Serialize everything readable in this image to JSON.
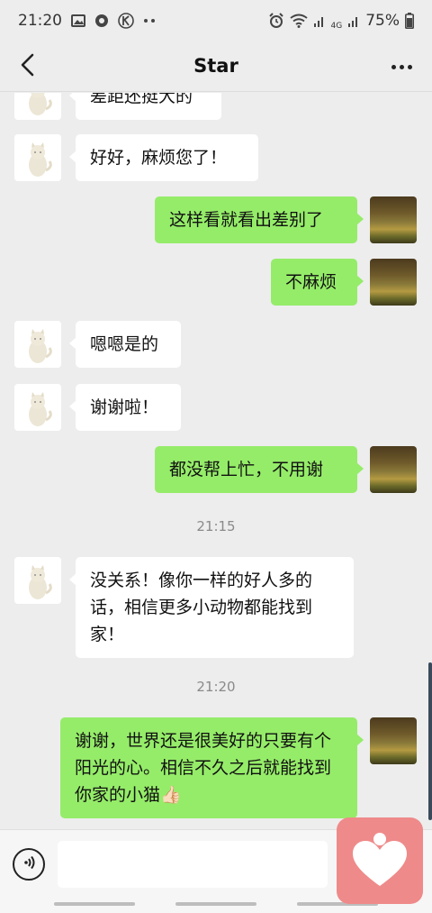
{
  "status_bar": {
    "time": "21:20",
    "battery": "75%",
    "network": "4G"
  },
  "header": {
    "title": "Star"
  },
  "messages": [
    {
      "side": "in",
      "text": "差距还挺大的"
    },
    {
      "side": "in",
      "text": "好好，麻烦您了！"
    },
    {
      "side": "out",
      "text": "这样看就看出差别了"
    },
    {
      "side": "out",
      "text": "不麻烦"
    },
    {
      "side": "in",
      "text": "嗯嗯是的"
    },
    {
      "side": "in",
      "text": "谢谢啦！"
    },
    {
      "side": "out",
      "text": "都没帮上忙，不用谢"
    },
    {
      "side": "in",
      "text": "没关系！像你一样的好人多的话，相信更多小动物都能找到家！"
    },
    {
      "side": "out",
      "text": "谢谢，世界还是很美好的只要有个阳光的心。相信不久之后就能找到你家的小猫👍🏻"
    }
  ],
  "timestamps": [
    "21:15",
    "21:20"
  ],
  "icons": {
    "back": "chevron-left-icon",
    "more": "more-dots-icon",
    "voice": "voice-icon",
    "heart": "heart-icon"
  },
  "colors": {
    "background": "#ededed",
    "outgoing_bubble": "#95ec69",
    "incoming_bubble": "#ffffff",
    "badge": "#ef8a8a"
  }
}
